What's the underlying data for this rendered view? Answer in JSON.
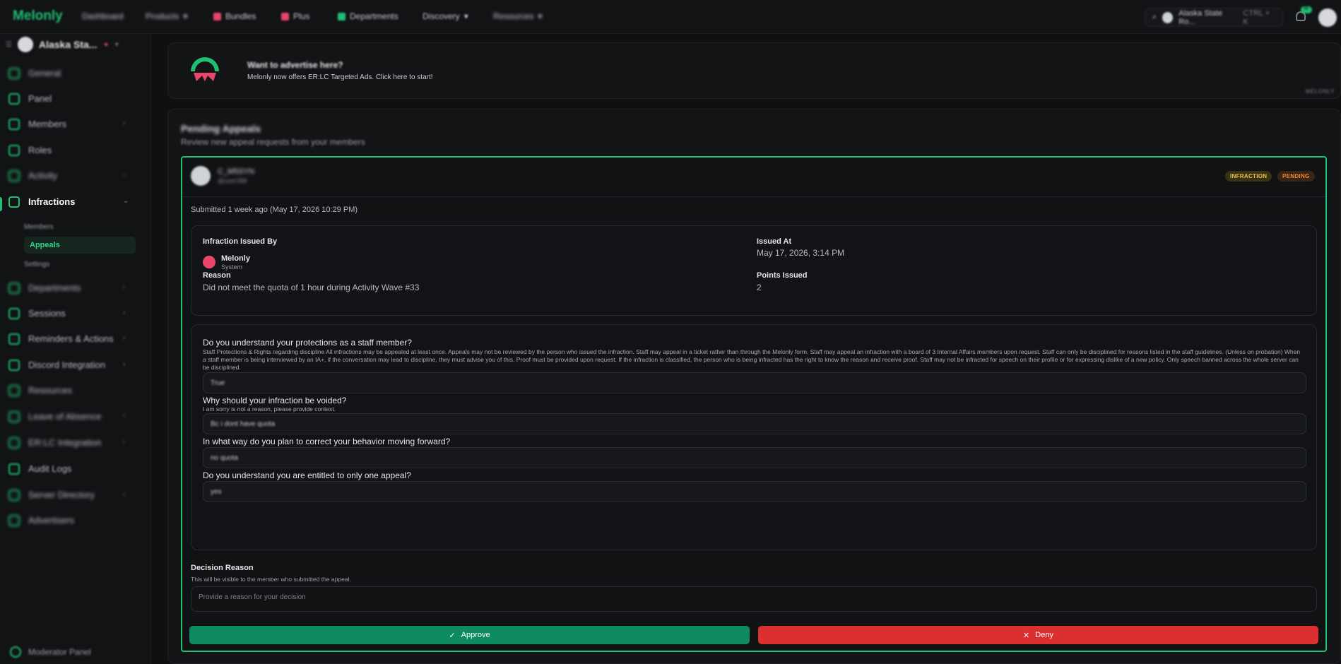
{
  "topnav": {
    "logo": "Melonly",
    "items": [
      "Dashboard",
      "Products",
      "Bundles",
      "Plus",
      "Departments",
      "Discovery",
      "Resources"
    ],
    "search_label": "Alaska State Ro...",
    "search_shortcut": "CTRL + K",
    "notif_count": "99"
  },
  "sidebar": {
    "server_name": "Alaska Sta...",
    "items": [
      "General",
      "Panel",
      "Members",
      "Roles",
      "Activity",
      "Infractions",
      "Departments",
      "Sessions",
      "Reminders & Actions",
      "Discord Integration",
      "Resources",
      "Leave of Absence",
      "ER:LC Integration",
      "Audit Logs",
      "Server Directory",
      "Advertisers"
    ],
    "sub_items": [
      "Members",
      "Appeals",
      "Settings"
    ],
    "footer": "Moderator Panel"
  },
  "ad": {
    "title": "Want to advertise here?",
    "subtitle": "Melonly now offers ER:LC Targeted Ads. Click here to start!",
    "tag": "MELONLY"
  },
  "appeals": {
    "title": "Pending Appeals",
    "subtitle": "Review new appeal requests from your members",
    "card": {
      "user_name": "C_M5SYN",
      "user_handle": "@user388",
      "badge_infraction": "INFRACTION",
      "badge_pending": "PENDING",
      "submitted": "Submitted 1 week ago (May 17, 2026 10:29 PM)",
      "issued_by_label": "Infraction Issued By",
      "issuer_name": "Melonly",
      "issuer_role": "System",
      "issued_at_label": "Issued At",
      "issued_at": "May 17, 2026, 3:14 PM",
      "reason_label": "Reason",
      "reason": "Did not meet the quota of 1 hour during Activity Wave #33",
      "points_label": "Points Issued",
      "points": "2",
      "questions": [
        {
          "q": "Do you understand your protections as a staff member?",
          "desc": "Staff Protections & Rights regarding discipline All infractions may be appealed at least once. Appeals may not be reviewed by the person who issued the infraction. Staff may appeal in a ticket rather than through the Melonly form. Staff may appeal an infraction with a board of 3 Internal Affairs members upon request. Staff can only be disciplined for reasons listed in the staff guidelines. (Unless on probation) When a staff member is being interviewed by an IA+, if the conversation may lead to discipline, they must advise you of this. Proof must be provided upon request. If the infraction is classified, the person who is being infracted has the right to know the reason and receive proof. Staff may not be infracted for speech on their profile or for expressing dislike of a new policy. Only speech banned across the whole server can be disciplined.",
          "a": "True"
        },
        {
          "q": "Why should your infraction be voided?",
          "desc": "I am sorry is not a reason, please provide context.",
          "a": "Bc i dont have quota"
        },
        {
          "q": "In what way do you plan to correct your behavior moving forward?",
          "desc": "",
          "a": "no quota"
        },
        {
          "q": "Do you understand you are entitled to only one appeal?",
          "desc": "",
          "a": "yes"
        }
      ],
      "decision_label": "Decision Reason",
      "decision_hint": "This will be visible to the member who submitted the appeal.",
      "decision_placeholder": "Provide a reason for your decision",
      "approve_label": "Approve",
      "deny_label": "Deny"
    }
  },
  "colors": {
    "accent": "#1fbf74",
    "approve": "#0e8a5f",
    "deny": "#dc2f2f",
    "badge_infraction": "#e7c24b",
    "badge_pending": "#f08a3a"
  }
}
